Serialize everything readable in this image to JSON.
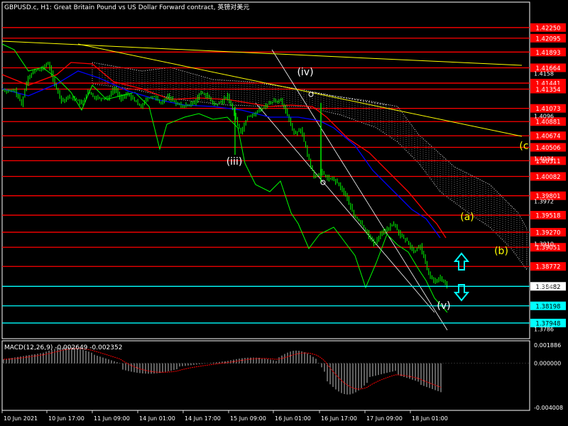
{
  "title": "GBPUSD.c, H1:  Great Britain Pound vs US Dollar Forward contract, 英镑对美元",
  "macd_label": "MACD(12,26,9) -0.002649 -0.002352",
  "colors": {
    "background": "#000000",
    "candle": "#00ff00",
    "resistance_line": "#ff0000",
    "support_line": "#00ffff",
    "trendline": "#ffff00",
    "ma_fast": "#ff0000",
    "ma_slow": "#0000ff",
    "channel": "#ffffff",
    "wave_white": "#ffffff",
    "wave_yellow": "#ffff00",
    "arrow": "#00ffff",
    "macd_hist": "#c0c0c0",
    "macd_signal": "#ff0000"
  },
  "chart_data": {
    "type": "candlestick",
    "symbol": "GBPUSD.c",
    "timeframe": "H1",
    "ylim": [
      1.3772,
      1.4262
    ],
    "price_ticks": [
      1.4158,
      1.4096,
      1.4034,
      1.3972,
      1.391,
      1.3848,
      1.3786
    ],
    "red_levels": [
      {
        "label": "1.42250",
        "value": 1.4225
      },
      {
        "label": "1.42095",
        "value": 1.42095
      },
      {
        "label": "1.41893",
        "value": 1.41893
      },
      {
        "label": "1.41664",
        "value": 1.41664
      },
      {
        "label": "1.41441",
        "value": 1.41441
      },
      {
        "label": "1.41354",
        "value": 1.41354
      },
      {
        "label": "1.41073",
        "value": 1.41073
      },
      {
        "label": "1.40881",
        "value": 1.40881
      },
      {
        "label": "1.40674",
        "value": 1.40674
      },
      {
        "label": "1.40506",
        "value": 1.40506
      },
      {
        "label": "1.40311",
        "value": 1.40311
      },
      {
        "label": "1.40082",
        "value": 1.40082
      },
      {
        "label": "1.39801",
        "value": 1.39801
      },
      {
        "label": "1.39518",
        "value": 1.39518
      },
      {
        "label": "1.39270",
        "value": 1.3927
      },
      {
        "label": "1.39051",
        "value": 1.39051
      },
      {
        "label": "1.38772",
        "value": 1.38772
      }
    ],
    "current_price": {
      "label": "1.38482",
      "value": 1.38482
    },
    "support_levels": [
      {
        "label": "1.38198",
        "value": 1.38198
      },
      {
        "label": "1.37948",
        "value": 1.37948
      }
    ],
    "time_labels": [
      "10 Jun 2021",
      "10 Jun 17:00",
      "11 Jun 09:00",
      "14 Jun 01:00",
      "14 Jun 17:00",
      "15 Jun 09:00",
      "16 Jun 01:00",
      "16 Jun 17:00",
      "17 Jun 09:00",
      "18 Jun 01:00"
    ],
    "close_series": [
      1.4132,
      1.4133,
      1.4114,
      1.4154,
      1.4162,
      1.4165,
      1.4174,
      1.4142,
      1.4119,
      1.4123,
      1.4122,
      1.4114,
      1.4131,
      1.4124,
      1.4122,
      1.4123,
      1.4137,
      1.4121,
      1.4129,
      1.4118,
      1.4111,
      1.4122,
      1.4124,
      1.4113,
      1.4125,
      1.4117,
      1.4111,
      1.4112,
      1.4116,
      1.4131,
      1.4125,
      1.4112,
      1.4116,
      1.4126,
      1.4098,
      1.4072,
      1.4096,
      1.4099,
      1.4106,
      1.4113,
      1.4119,
      1.4118,
      1.4098,
      1.4071,
      1.4077,
      1.4041,
      1.4008,
      1.4015,
      1.4006,
      1.4003,
      1.3993,
      1.3976,
      1.3951,
      1.3941,
      1.3926,
      1.3909,
      1.3925,
      1.3932,
      1.3939,
      1.3922,
      1.3914,
      1.3898,
      1.3908,
      1.3872,
      1.3855,
      1.3862,
      1.3848
    ],
    "wave_labels": [
      {
        "text": "(iv)",
        "color": "white"
      },
      {
        "text": "(iii)",
        "color": "white"
      },
      {
        "text": "(v)",
        "color": "white"
      },
      {
        "text": "(a)",
        "color": "yellow"
      },
      {
        "text": "(b)",
        "color": "yellow"
      },
      {
        "text": "(c",
        "color": "yellow"
      }
    ],
    "macd": {
      "ticks": [
        "0.001886",
        "0.000000",
        "-0.004008"
      ],
      "ylim": [
        -0.004008,
        0.001886
      ]
    }
  }
}
